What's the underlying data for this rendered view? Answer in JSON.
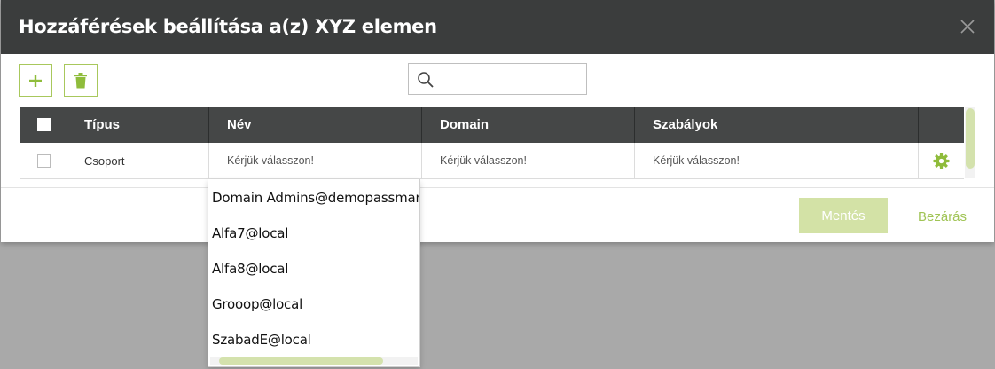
{
  "dialog": {
    "title": "Hozzáférések beállítása a(z) XYZ elemen"
  },
  "toolbar": {
    "add_icon": "plus-icon",
    "delete_icon": "trash-icon",
    "search": {
      "value": "",
      "placeholder": ""
    }
  },
  "table": {
    "columns": [
      "Típus",
      "Név",
      "Domain",
      "Szabályok"
    ],
    "rows": [
      {
        "type": "Csoport",
        "name": "Kérjük válasszon!",
        "domain": "Kérjük válasszon!",
        "rules": "Kérjük válasszon!"
      }
    ]
  },
  "dropdown": {
    "options": [
      "Domain Admins@demopassmanad",
      "Alfa7@local",
      "Alfa8@local",
      "Grooop@local",
      "SzabadE@local"
    ]
  },
  "footer": {
    "save_label": "Mentés",
    "close_label": "Bezárás"
  },
  "colors": {
    "accent": "#a0c455",
    "header_bg": "#3b3d3d",
    "table_header_bg": "#454747"
  }
}
